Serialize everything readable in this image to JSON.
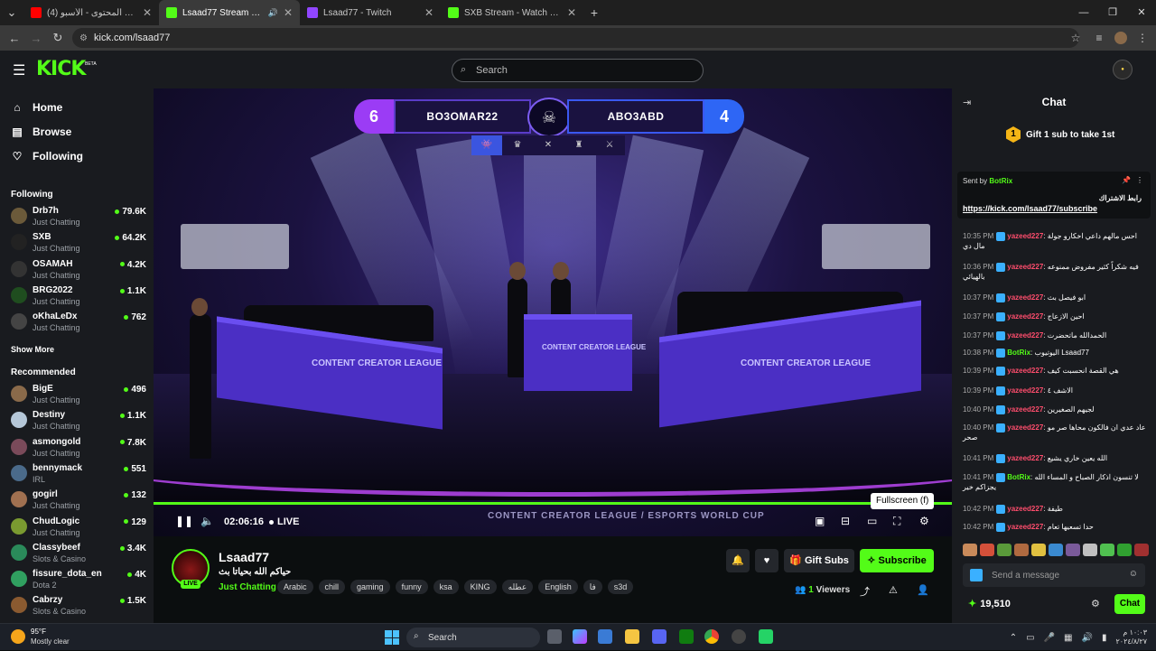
{
  "browser": {
    "tabs": [
      {
        "title": "(4) ‏دوري صناع المحتوى - الأسبو",
        "favicon_color": "#ff0000"
      },
      {
        "title": "Lsaad77 Stream - Watch Live",
        "favicon_color": "#53fc18",
        "active": true
      },
      {
        "title": "Lsaad77 - Twitch",
        "favicon_color": "#9146ff"
      },
      {
        "title": "SXB Stream - Watch Live on Kick",
        "favicon_color": "#53fc18"
      }
    ],
    "url": "kick.com/lsaad77",
    "new_tab": "+"
  },
  "kick": {
    "logo": "KICK",
    "beta": "BETA",
    "search_placeholder": "Search"
  },
  "sidebar": {
    "nav": [
      {
        "label": "Home",
        "icon": "home-icon"
      },
      {
        "label": "Browse",
        "icon": "browse-icon"
      },
      {
        "label": "Following",
        "icon": "heart-icon"
      }
    ],
    "following_title": "Following",
    "following": [
      {
        "name": "Drb7h",
        "category": "Just Chatting",
        "viewers": "79.6K",
        "color": "#6b5a3a"
      },
      {
        "name": "SXB",
        "category": "Just Chatting",
        "viewers": "64.2K",
        "color": "#222"
      },
      {
        "name": "OSAMAH",
        "category": "Just Chatting",
        "viewers": "4.2K",
        "color": "#333"
      },
      {
        "name": "BRG2022",
        "category": "Just Chatting",
        "viewers": "1.1K",
        "color": "#1f4d1f"
      },
      {
        "name": "oKhaLeDx",
        "category": "Just Chatting",
        "viewers": "762",
        "color": "#444"
      }
    ],
    "show_more": "Show More",
    "recommended_title": "Recommended",
    "recommended": [
      {
        "name": "BigE",
        "category": "Just Chatting",
        "viewers": "496",
        "color": "#8a6a4a"
      },
      {
        "name": "Destiny",
        "category": "Just Chatting",
        "viewers": "1.1K",
        "color": "#b5c7d8"
      },
      {
        "name": "asmongold",
        "category": "Just Chatting",
        "viewers": "7.8K",
        "color": "#7a4a5a"
      },
      {
        "name": "bennymack",
        "category": "IRL",
        "viewers": "551",
        "color": "#4a6a8a"
      },
      {
        "name": "gogirl",
        "category": "Just Chatting",
        "viewers": "132",
        "color": "#a07050"
      },
      {
        "name": "ChudLogic",
        "category": "Just Chatting",
        "viewers": "129",
        "color": "#7a9a30"
      },
      {
        "name": "Classybeef",
        "category": "Slots & Casino",
        "viewers": "3.4K",
        "color": "#2a8a5a"
      },
      {
        "name": "fissure_dota_en",
        "category": "Dota 2",
        "viewers": "4K",
        "color": "#30a060"
      },
      {
        "name": "Cabrzy",
        "category": "Slots & Casino",
        "viewers": "1.5K",
        "color": "#8a5a30"
      }
    ]
  },
  "video": {
    "score": {
      "left_score": "6",
      "left_team": "BO3OMAR22",
      "right_team": "ABO3ABD",
      "right_score": "4",
      "round_icons": [
        "👾",
        "♛",
        "✕",
        "♜",
        "⚔"
      ]
    },
    "desk_logo": "CONTENT CREATOR LEAGUE",
    "overlay_logo": "CONTENT CREATOR LEAGUE / ESPORTS WORLD CUP",
    "time": "02:06:16",
    "live": "LIVE",
    "tooltip": "Fullscreen (f)"
  },
  "stream": {
    "name": "Lsaad77",
    "title": "حياكم الله بحياتا بث",
    "category": "Just Chatting",
    "live_badge": "LIVE",
    "tags": [
      "Arabic",
      "chill",
      "gaming",
      "funny",
      "ksa",
      "KING",
      "عطله",
      "English",
      "فا",
      "s3d"
    ],
    "gift_label": "Gift Subs",
    "subscribe_label": "Subscribe",
    "viewers_count": "1",
    "viewers_label": "Viewers"
  },
  "chat": {
    "title": "Chat",
    "gift_banner": "Gift 1 sub to take 1st",
    "gift_badge": "1",
    "pinned_by_prefix": "Sent by",
    "pinned_by": "BotRix",
    "pinned_text": "رابط الاشتراك",
    "pinned_link": "https://kick.com/lsaad77/subscribe",
    "messages": [
      {
        "time": "10:35 PM",
        "user": "yazeed227",
        "text": "احس مالهم داعي اخكارو جولة مال دي",
        "user_color": "#ff4d6d"
      },
      {
        "time": "10:36 PM",
        "user": "yazeed227",
        "text": "فيه شكراً كثير مفروض ممنوعه بالهيائي",
        "user_color": "#ff4d6d"
      },
      {
        "time": "10:37 PM",
        "user": "yazeed227",
        "text": "ابو فيصل بث",
        "user_color": "#ff4d6d"
      },
      {
        "time": "10:37 PM",
        "user": "yazeed227",
        "text": "احين الازعاج",
        "user_color": "#ff4d6d"
      },
      {
        "time": "10:37 PM",
        "user": "yazeed227",
        "text": "الحمدالله ماتحضرت",
        "user_color": "#ff4d6d"
      },
      {
        "time": "10:38 PM",
        "user": "BotRix",
        "text": "اليوتيوب Lsaad77",
        "user_color": "#53fc18"
      },
      {
        "time": "10:39 PM",
        "user": "yazeed227",
        "text": "هي القصة انحسبت كيف",
        "user_color": "#ff4d6d"
      },
      {
        "time": "10:39 PM",
        "user": "yazeed227",
        "text": "الاشف ٤",
        "user_color": "#ff4d6d"
      },
      {
        "time": "10:40 PM",
        "user": "yazeed227",
        "text": "لجيهم الصغيرين",
        "user_color": "#ff4d6d"
      },
      {
        "time": "10:40 PM",
        "user": "yazeed227",
        "text": "عاد عدي ان فالكون محاها صر مو صحر",
        "user_color": "#ff4d6d"
      },
      {
        "time": "10:41 PM",
        "user": "yazeed227",
        "text": "الله يعين خاري يشيع",
        "user_color": "#ff4d6d"
      },
      {
        "time": "10:41 PM",
        "user": "BotRix",
        "text": "لا تنسون اذكار الصباح و المساء الله يجزاكم خير",
        "user_color": "#53fc18"
      },
      {
        "time": "10:42 PM",
        "user": "yazeed227",
        "text": "طيفة",
        "user_color": "#ff4d6d"
      },
      {
        "time": "10:42 PM",
        "user": "yazeed227",
        "text": "حدا تسعيها تعام",
        "user_color": "#ff4d6d"
      }
    ],
    "send_placeholder": "Send a message",
    "points": "19,510",
    "chat_button": "Chat"
  },
  "taskbar": {
    "temp": "95°F",
    "condition": "Mostly clear",
    "search": "Search",
    "time": "١٠:٠٣ م",
    "date": "٢٠٢٤/٨/٢٧"
  }
}
